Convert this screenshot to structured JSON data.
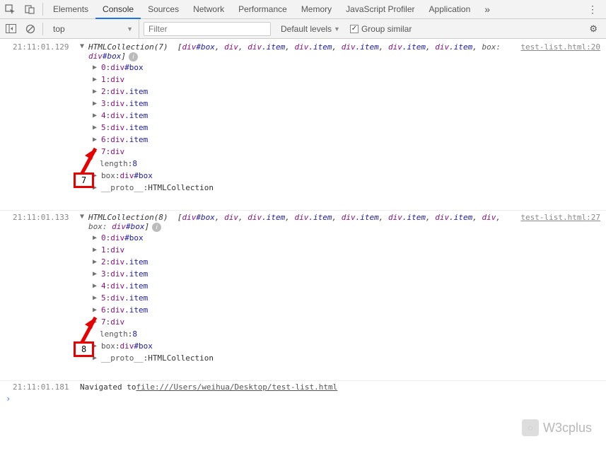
{
  "tabs": [
    "Elements",
    "Console",
    "Sources",
    "Network",
    "Performance",
    "Memory",
    "JavaScript Profiler",
    "Application"
  ],
  "active_tab": "Console",
  "toolbar": {
    "context": "top",
    "filter_placeholder": "Filter",
    "levels": "Default levels",
    "group_similar": "Group similar"
  },
  "logs": [
    {
      "timestamp": "21:11:01.129",
      "source": {
        "file": "test-list.html",
        "line": "20"
      },
      "head_label": "HTMLCollection(7)",
      "inline": [
        "div#box",
        "div",
        "div.item",
        "div.item",
        "div.item",
        "div.item",
        "div.item",
        "box",
        "div#box"
      ],
      "box_key_index": 7,
      "props": [
        {
          "k": "0",
          "v": "div#box"
        },
        {
          "k": "1",
          "v": "div"
        },
        {
          "k": "2",
          "v": "div.item"
        },
        {
          "k": "3",
          "v": "div.item"
        },
        {
          "k": "4",
          "v": "div.item"
        },
        {
          "k": "5",
          "v": "div.item"
        },
        {
          "k": "6",
          "v": "div.item"
        },
        {
          "k": "7",
          "v": "div"
        }
      ],
      "length": "8",
      "box_key": "box",
      "box_val": "div#box",
      "proto": "__proto__",
      "proto_val": "HTMLCollection",
      "annotation": "7"
    },
    {
      "timestamp": "21:11:01.133",
      "source": {
        "file": "test-list.html",
        "line": "27"
      },
      "head_label": "HTMLCollection(8)",
      "inline": [
        "div#box",
        "div",
        "div.item",
        "div.item",
        "div.item",
        "div.item",
        "div.item",
        "div",
        "box",
        "div#box"
      ],
      "box_key_index": 8,
      "props": [
        {
          "k": "0",
          "v": "div#box"
        },
        {
          "k": "1",
          "v": "div"
        },
        {
          "k": "2",
          "v": "div.item"
        },
        {
          "k": "3",
          "v": "div.item"
        },
        {
          "k": "4",
          "v": "div.item"
        },
        {
          "k": "5",
          "v": "div.item"
        },
        {
          "k": "6",
          "v": "div.item"
        },
        {
          "k": "7",
          "v": "div"
        }
      ],
      "length": "8",
      "box_key": "box",
      "box_val": "div#box",
      "proto": "__proto__",
      "proto_val": "HTMLCollection",
      "annotation": "8"
    }
  ],
  "navigate": {
    "timestamp": "21:11:01.181",
    "prefix": "Navigated to ",
    "url": "file:///Users/weihua/Desktop/test-list.html"
  },
  "watermark": "W3cplus"
}
